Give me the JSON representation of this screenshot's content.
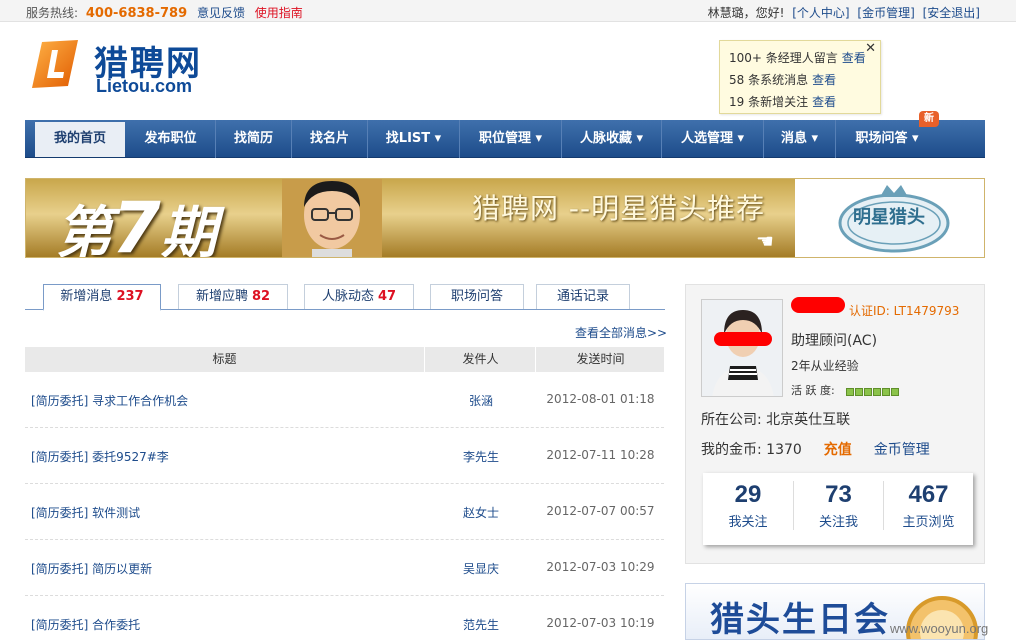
{
  "topbar": {
    "hotline_label": "服务热线:",
    "hotline_number": "400-6838-789",
    "feedback": "意见反馈",
    "guide": "使用指南",
    "greeting": "林慧璐，您好!",
    "personal_center": "[个人中心]",
    "coin_manage": "[金币管理]",
    "logout": "[安全退出]"
  },
  "logo": {
    "cn": "猎聘网",
    "en_1": "Lietou",
    "en_2": ".com"
  },
  "notice": {
    "rows": [
      {
        "text": "100+ 条经理人留言",
        "link": "查看"
      },
      {
        "text": "58 条系统消息",
        "link": "查看"
      },
      {
        "text": "19 条新增关注",
        "link": "查看"
      }
    ],
    "close": "✕"
  },
  "nav": {
    "items": [
      "我的首页",
      "发布职位",
      "找简历",
      "找名片",
      "找LIST ▾",
      "职位管理 ▾",
      "人脉收藏 ▾",
      "人选管理 ▾",
      "消息 ▾",
      "职场问答 ▾"
    ],
    "badge": "新"
  },
  "banner": {
    "issue_pre": "第",
    "issue_num": "7",
    "issue_post": "期",
    "title": "猎聘网 --明星猎头推荐",
    "seal": "明星猎头"
  },
  "tabs": [
    {
      "label": "新增消息",
      "count": "237"
    },
    {
      "label": "新增应聘",
      "count": "82"
    },
    {
      "label": "人脉动态",
      "count": "47"
    },
    {
      "label": "职场问答",
      "count": ""
    },
    {
      "label": "通话记录",
      "count": ""
    }
  ],
  "view_all": "查看全部消息>>",
  "table": {
    "headers": [
      "标题",
      "发件人",
      "发送时间"
    ],
    "rows": [
      {
        "title": "[简历委托] 寻求工作合作机会",
        "sender": "张涵",
        "time": "2012-08-01 01:18"
      },
      {
        "title": "[简历委托] 委托9527#李",
        "sender": "李先生",
        "time": "2012-07-11 10:28"
      },
      {
        "title": "[简历委托] 软件测试",
        "sender": "赵女士",
        "time": "2012-07-07 00:57"
      },
      {
        "title": "[简历委托] 简历以更新",
        "sender": "吴显庆",
        "time": "2012-07-03 10:29"
      },
      {
        "title": "[简历委托] 合作委托",
        "sender": "范先生",
        "time": "2012-07-03 10:19"
      }
    ]
  },
  "profile": {
    "cert": "认证ID: LT1479793",
    "title": "助理顾问(AC)",
    "years": "2年从业经验",
    "activity_label": "活 跃 度:",
    "activity_level": 6,
    "activity_max": 6,
    "company": "所在公司: 北京英仕互联",
    "coins_label": "我的金币: 1370",
    "recharge": "充值",
    "coin_manage": "金币管理",
    "stats": [
      {
        "num": "29",
        "label": "我关注"
      },
      {
        "num": "73",
        "label": "关注我"
      },
      {
        "num": "467",
        "label": "主页浏览"
      }
    ]
  },
  "bday": {
    "text": "猎头生日会"
  },
  "watermark": "www.wooyun.org",
  "colors": {
    "brand_blue": "#1e4c8c",
    "brand_orange": "#e46a00",
    "alert_red": "#dd1122"
  }
}
